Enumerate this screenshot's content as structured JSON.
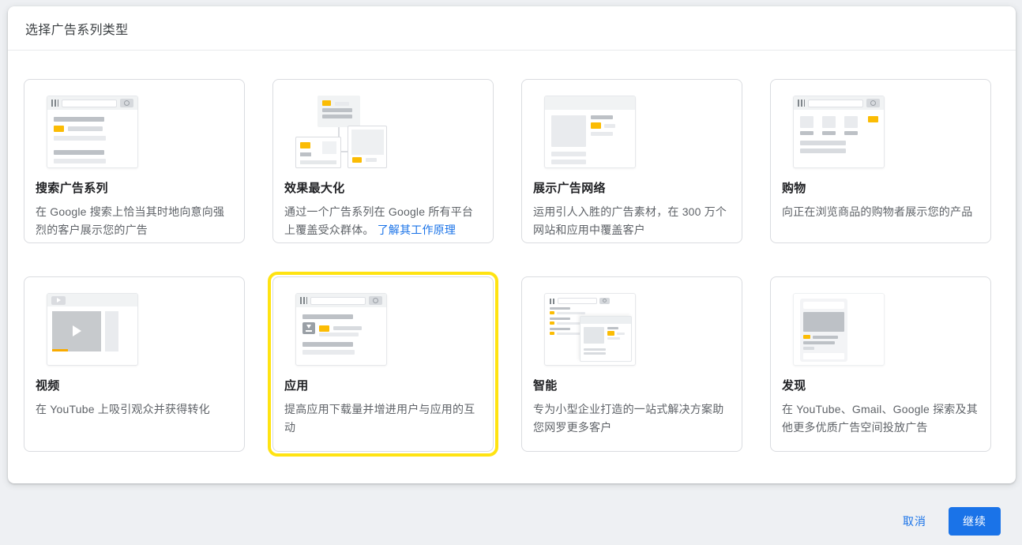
{
  "dialog": {
    "title": "选择广告系列类型"
  },
  "colors": {
    "accent_blue": "#1a73e8",
    "badge_yellow": "#fbbc04",
    "selection_yellow": "#ffe312"
  },
  "cards": [
    {
      "id": "search",
      "title": "搜索广告系列",
      "description": "在 Google 搜索上恰当其时地向意向强烈的客户展示您的广告",
      "selected": false
    },
    {
      "id": "performance-max",
      "title": "效果最大化",
      "description": "通过一个广告系列在 Google 所有平台上覆盖受众群体。 ",
      "link_label": "了解其工作原理",
      "selected": false
    },
    {
      "id": "display",
      "title": "展示广告网络",
      "description": "运用引人入胜的广告素材，在 300 万个网站和应用中覆盖客户",
      "selected": false
    },
    {
      "id": "shopping",
      "title": "购物",
      "description": "向正在浏览商品的购物者展示您的产品",
      "selected": false
    },
    {
      "id": "video",
      "title": "视频",
      "description": "在 YouTube 上吸引观众并获得转化",
      "selected": false
    },
    {
      "id": "app",
      "title": "应用",
      "description": "提高应用下载量并增进用户与应用的互动",
      "selected": true
    },
    {
      "id": "smart",
      "title": "智能",
      "description": "专为小型企业打造的一站式解决方案助您网罗更多客户",
      "selected": false
    },
    {
      "id": "discovery",
      "title": "发现",
      "description": "在 YouTube、Gmail、Google 探索及其他更多优质广告空间投放广告",
      "selected": false
    }
  ],
  "footer": {
    "cancel_label": "取消",
    "continue_label": "继续"
  }
}
